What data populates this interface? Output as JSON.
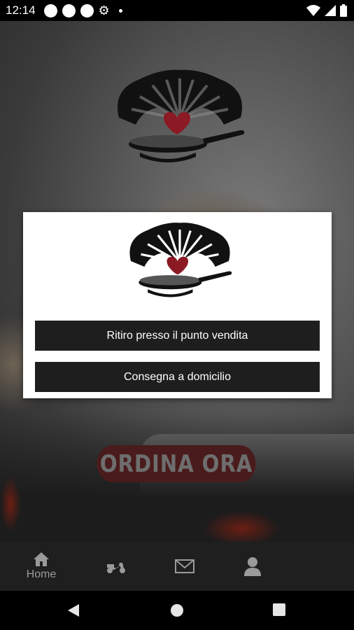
{
  "status_bar": {
    "time": "12:14",
    "icons": [
      "circle-icon",
      "circle-icon",
      "circle-icon",
      "gear-icon",
      "dot-icon",
      "wifi-icon",
      "signal-icon",
      "battery-icon"
    ]
  },
  "background": {
    "order_now_label": "ORDINA ORA",
    "info_icon": "i"
  },
  "modal": {
    "pickup_label": "Ritiro presso il punto vendita",
    "delivery_label": "Consegna a domicilio"
  },
  "tabbar": {
    "items": [
      {
        "icon": "home-icon",
        "label": "Home"
      },
      {
        "icon": "scooter-icon",
        "label": ""
      },
      {
        "icon": "mail-icon",
        "label": ""
      },
      {
        "icon": "user-icon",
        "label": ""
      }
    ]
  },
  "colors": {
    "modal_button_bg": "#1e1e1e",
    "order_button_bg": "#4a1b1c",
    "logo_heart": "#8b1a24"
  }
}
